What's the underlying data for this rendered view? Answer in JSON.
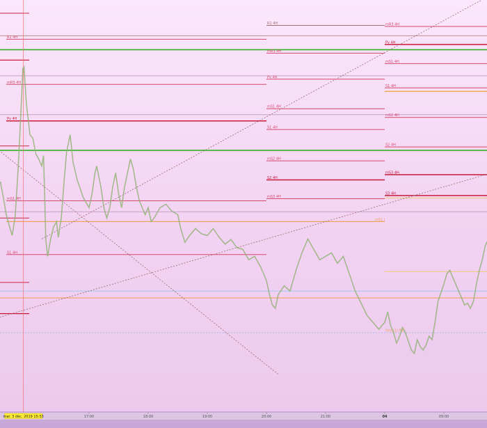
{
  "chart_data": {
    "type": "line",
    "title": "",
    "xlabel": "",
    "ylabel": "",
    "x_ticks": [
      {
        "label": "17:00",
        "t": 17.0,
        "bold": false
      },
      {
        "label": "18:00",
        "t": 18.0,
        "bold": false
      },
      {
        "label": "19:00",
        "t": 19.0,
        "bold": false
      },
      {
        "label": "20:00",
        "t": 20.0,
        "bold": false
      },
      {
        "label": "21:00",
        "t": 21.0,
        "bold": false
      },
      {
        "label": "04",
        "t": 22.0,
        "bold": true
      },
      {
        "label": "09:00",
        "t": 23.0,
        "bold": false
      }
    ],
    "cursor": {
      "label": "mar. 3 déc. 2019 15:53",
      "t": 15.89
    },
    "price_series": {
      "name": "",
      "color": "#8fc27a",
      "points": [
        [
          15.5,
          0.515
        ],
        [
          15.55,
          0.47
        ],
        [
          15.6,
          0.42
        ],
        [
          15.65,
          0.388
        ],
        [
          15.7,
          0.36
        ],
        [
          15.75,
          0.415
        ],
        [
          15.8,
          0.55
        ],
        [
          15.83,
          0.655
        ],
        [
          15.86,
          0.76
        ],
        [
          15.88,
          0.84
        ],
        [
          15.9,
          0.845
        ],
        [
          15.94,
          0.74
        ],
        [
          16.0,
          0.65
        ],
        [
          16.05,
          0.64
        ],
        [
          16.1,
          0.595
        ],
        [
          16.15,
          0.58
        ],
        [
          16.2,
          0.56
        ],
        [
          16.23,
          0.59
        ],
        [
          16.27,
          0.345
        ],
        [
          16.3,
          0.3
        ],
        [
          16.35,
          0.35
        ],
        [
          16.4,
          0.385
        ],
        [
          16.45,
          0.4
        ],
        [
          16.48,
          0.355
        ],
        [
          16.53,
          0.41
        ],
        [
          16.58,
          0.52
        ],
        [
          16.62,
          0.6
        ],
        [
          16.68,
          0.65
        ],
        [
          16.73,
          0.57
        ],
        [
          16.8,
          0.52
        ],
        [
          16.9,
          0.47
        ],
        [
          17.0,
          0.44
        ],
        [
          17.05,
          0.48
        ],
        [
          17.1,
          0.54
        ],
        [
          17.13,
          0.56
        ],
        [
          17.2,
          0.5
        ],
        [
          17.25,
          0.44
        ],
        [
          17.3,
          0.41
        ],
        [
          17.35,
          0.44
        ],
        [
          17.4,
          0.5
        ],
        [
          17.45,
          0.54
        ],
        [
          17.5,
          0.48
        ],
        [
          17.55,
          0.44
        ],
        [
          17.6,
          0.5
        ],
        [
          17.65,
          0.54
        ],
        [
          17.7,
          0.58
        ],
        [
          17.75,
          0.55
        ],
        [
          17.8,
          0.5
        ],
        [
          17.85,
          0.46
        ],
        [
          17.9,
          0.44
        ],
        [
          17.95,
          0.42
        ],
        [
          18.0,
          0.44
        ],
        [
          18.05,
          0.4
        ],
        [
          18.1,
          0.41
        ],
        [
          18.2,
          0.44
        ],
        [
          18.3,
          0.45
        ],
        [
          18.4,
          0.43
        ],
        [
          18.5,
          0.42
        ],
        [
          18.55,
          0.38
        ],
        [
          18.62,
          0.34
        ],
        [
          18.7,
          0.36
        ],
        [
          18.8,
          0.38
        ],
        [
          18.9,
          0.365
        ],
        [
          19.0,
          0.36
        ],
        [
          19.1,
          0.38
        ],
        [
          19.2,
          0.355
        ],
        [
          19.3,
          0.335
        ],
        [
          19.4,
          0.348
        ],
        [
          19.5,
          0.325
        ],
        [
          19.6,
          0.32
        ],
        [
          19.7,
          0.29
        ],
        [
          19.8,
          0.3
        ],
        [
          19.9,
          0.27
        ],
        [
          20.0,
          0.23
        ],
        [
          20.05,
          0.19
        ],
        [
          20.1,
          0.16
        ],
        [
          20.15,
          0.15
        ],
        [
          20.2,
          0.19
        ],
        [
          20.3,
          0.215
        ],
        [
          20.4,
          0.2
        ],
        [
          20.5,
          0.26
        ],
        [
          20.6,
          0.31
        ],
        [
          20.7,
          0.35
        ],
        [
          20.8,
          0.32
        ],
        [
          20.9,
          0.29
        ],
        [
          21.0,
          0.3
        ],
        [
          21.1,
          0.31
        ],
        [
          21.2,
          0.28
        ],
        [
          21.3,
          0.3
        ],
        [
          21.4,
          0.25
        ],
        [
          21.5,
          0.2
        ],
        [
          21.6,
          0.165
        ],
        [
          21.7,
          0.13
        ],
        [
          21.8,
          0.11
        ],
        [
          21.9,
          0.09
        ],
        [
          22.0,
          0.11
        ],
        [
          22.05,
          0.14
        ],
        [
          22.1,
          0.1
        ],
        [
          22.15,
          0.08
        ],
        [
          22.2,
          0.05
        ],
        [
          22.25,
          0.07
        ],
        [
          22.3,
          0.095
        ],
        [
          22.35,
          0.08
        ],
        [
          22.4,
          0.055
        ],
        [
          22.45,
          0.03
        ],
        [
          22.5,
          0.02
        ],
        [
          22.55,
          0.06
        ],
        [
          22.6,
          0.04
        ],
        [
          22.65,
          0.03
        ],
        [
          22.7,
          0.045
        ],
        [
          22.75,
          0.07
        ],
        [
          22.8,
          0.06
        ],
        [
          22.85,
          0.11
        ],
        [
          22.9,
          0.17
        ],
        [
          23.0,
          0.22
        ],
        [
          23.05,
          0.25
        ],
        [
          23.1,
          0.26
        ],
        [
          23.15,
          0.24
        ],
        [
          23.2,
          0.22
        ],
        [
          23.25,
          0.2
        ],
        [
          23.3,
          0.18
        ],
        [
          23.35,
          0.16
        ],
        [
          23.4,
          0.165
        ],
        [
          23.45,
          0.15
        ],
        [
          23.5,
          0.17
        ],
        [
          23.55,
          0.22
        ],
        [
          23.6,
          0.26
        ],
        [
          23.65,
          0.29
        ],
        [
          23.7,
          0.33
        ],
        [
          23.75,
          0.35
        ],
        [
          23.8,
          0.33
        ],
        [
          23.85,
          0.28
        ],
        [
          23.9,
          0.24
        ],
        [
          23.95,
          0.195
        ],
        [
          24.0,
          0.165
        ],
        [
          24.05,
          0.14
        ],
        [
          24.1,
          0.12
        ],
        [
          24.15,
          0.1
        ],
        [
          24.2,
          0.115
        ],
        [
          24.25,
          0.09
        ],
        [
          24.3,
          0.075
        ],
        [
          24.35,
          0.06
        ],
        [
          24.4,
          0.05
        ],
        [
          24.45,
          0.045
        ],
        [
          24.55,
          0.06
        ],
        [
          24.65,
          0.04
        ],
        [
          24.75,
          0.02
        ]
      ]
    },
    "pivot_levels": [
      {
        "label": "R1 4H",
        "y": 0.925,
        "t0": 15.6,
        "t1": 20.0,
        "color": "#d34a6a"
      },
      {
        "label": "mR3 4H",
        "y": 0.795,
        "t0": 15.6,
        "t1": 20.0,
        "color": "#d34a6a"
      },
      {
        "label": "Pv 4H",
        "y": 0.69,
        "t0": 15.6,
        "t1": 20.0,
        "color": "#d21a3a"
      },
      {
        "label": "mS1 4H",
        "y": 0.46,
        "t0": 15.6,
        "t1": 20.0,
        "color": "#d34a6a"
      },
      {
        "label": "S1 4H",
        "y": 0.305,
        "t0": 15.6,
        "t1": 20.0,
        "color": "#d34a6a"
      },
      {
        "label": "R1 4H",
        "y": 0.965,
        "t0": 20.0,
        "t1": 22.0,
        "color": "#a07070"
      },
      {
        "label": "mR3 4H",
        "y": 0.885,
        "t0": 20.0,
        "t1": 22.0,
        "color": "#d34a6a"
      },
      {
        "label": "Pv 4H",
        "y": 0.81,
        "t0": 20.0,
        "t1": 22.0,
        "color": "#d34a6a"
      },
      {
        "label": "mS1 4H",
        "y": 0.725,
        "t0": 20.0,
        "t1": 22.0,
        "color": "#d34a6a"
      },
      {
        "label": "S1 4H",
        "y": 0.665,
        "t0": 20.0,
        "t1": 22.0,
        "color": "#d34a6a"
      },
      {
        "label": "mS2 4H",
        "y": 0.575,
        "t0": 20.0,
        "t1": 22.0,
        "color": "#d34a6a"
      },
      {
        "label": "S2 4H",
        "y": 0.52,
        "t0": 20.0,
        "t1": 22.0,
        "color": "#c41a3a"
      },
      {
        "label": "mS3 4H",
        "y": 0.466,
        "t0": 20.0,
        "t1": 22.0,
        "color": "#d34a6a"
      },
      {
        "label": "mR3 4H",
        "y": 0.962,
        "t0": 22.0,
        "t1": 25.0,
        "color": "#d34a6a"
      },
      {
        "label": "Pv 4H",
        "y": 0.91,
        "t0": 22.0,
        "t1": 25.0,
        "color": "#c41a3a"
      },
      {
        "label": "mS1 4H",
        "y": 0.855,
        "t0": 22.0,
        "t1": 25.0,
        "color": "#d34a6a"
      },
      {
        "label": "S1 4H",
        "y": 0.785,
        "t0": 22.0,
        "t1": 25.0,
        "color": "#d34a6a"
      },
      {
        "label": "mS2 4H",
        "y": 0.7,
        "t0": 22.0,
        "t1": 25.0,
        "color": "#d34a6a"
      },
      {
        "label": "S2 4H",
        "y": 0.615,
        "t0": 22.0,
        "t1": 25.0,
        "color": "#d34a6a"
      },
      {
        "label": "mS3 4H",
        "y": 0.535,
        "t0": 22.0,
        "t1": 25.0,
        "color": "#c41a3a"
      },
      {
        "label": "S3 4H",
        "y": 0.475,
        "t0": 22.0,
        "t1": 25.0,
        "color": "#c41a3a"
      }
    ],
    "left_levels": [
      {
        "y": 1.0,
        "color": "#d34a6a"
      },
      {
        "y": 0.865,
        "color": "#d21a3a"
      },
      {
        "y": 0.618,
        "color": "#d34a6a"
      },
      {
        "y": 0.41,
        "color": "#d34a6a"
      },
      {
        "y": 0.225,
        "color": "#d34a6a"
      },
      {
        "y": 0.135,
        "color": "#c41a3a"
      }
    ],
    "full_width_levels": [
      {
        "y": 1.04,
        "color": "#7fd8ee"
      },
      {
        "y": 0.935,
        "color": "#b89090"
      },
      {
        "y": 0.895,
        "color": "#34b025"
      },
      {
        "y": 0.82,
        "color": "#c8a0c8"
      },
      {
        "y": 0.708,
        "color": "#c8a0c8"
      },
      {
        "y": 0.605,
        "color": "#34b025"
      },
      {
        "y": 0.428,
        "color": "#c8a0c8"
      },
      {
        "y": 0.2,
        "color": "#9fc8ee"
      },
      {
        "y": 0.18,
        "color": "#f0a050"
      }
    ],
    "side_levels": [
      {
        "y": 0.775,
        "t0": 22.0,
        "t1": 25.0,
        "color": "#f0a030"
      },
      {
        "y": 0.468,
        "t0": 22.0,
        "t1": 25.0,
        "color": "#f0c890"
      },
      {
        "y": 0.256,
        "t0": 22.0,
        "t1": 25.0,
        "color": "#f0c890"
      },
      {
        "y": 0.4,
        "t0": 15.6,
        "t1": 22.0,
        "color": "#f0a060"
      }
    ],
    "side_labels": [
      {
        "label": "mS1 j",
        "y": 0.4,
        "t": 22.0,
        "color": "#f0a060"
      },
      {
        "label": "Des (1) Pav",
        "y": 0.08,
        "t": 22.0,
        "color": "#f0a060"
      }
    ],
    "dotted_levels": [
      {
        "y": 0.08,
        "color": "#9fbbe0"
      }
    ],
    "trendlines": [
      {
        "t0": 16.2,
        "y0": 0.35,
        "t1": 24.2,
        "y1": 1.09,
        "color": "#9a6a6a"
      },
      {
        "t0": 15.4,
        "y0": 0.12,
        "t1": 25.0,
        "y1": 0.6,
        "color": "#9a6a6a"
      },
      {
        "t0": 15.0,
        "y0": 0.67,
        "t1": 20.2,
        "y1": -0.04,
        "color": "#9a6a6a"
      }
    ],
    "x_range": [
      15.5,
      25.0
    ],
    "y_range": [
      0.0,
      1.08
    ]
  }
}
